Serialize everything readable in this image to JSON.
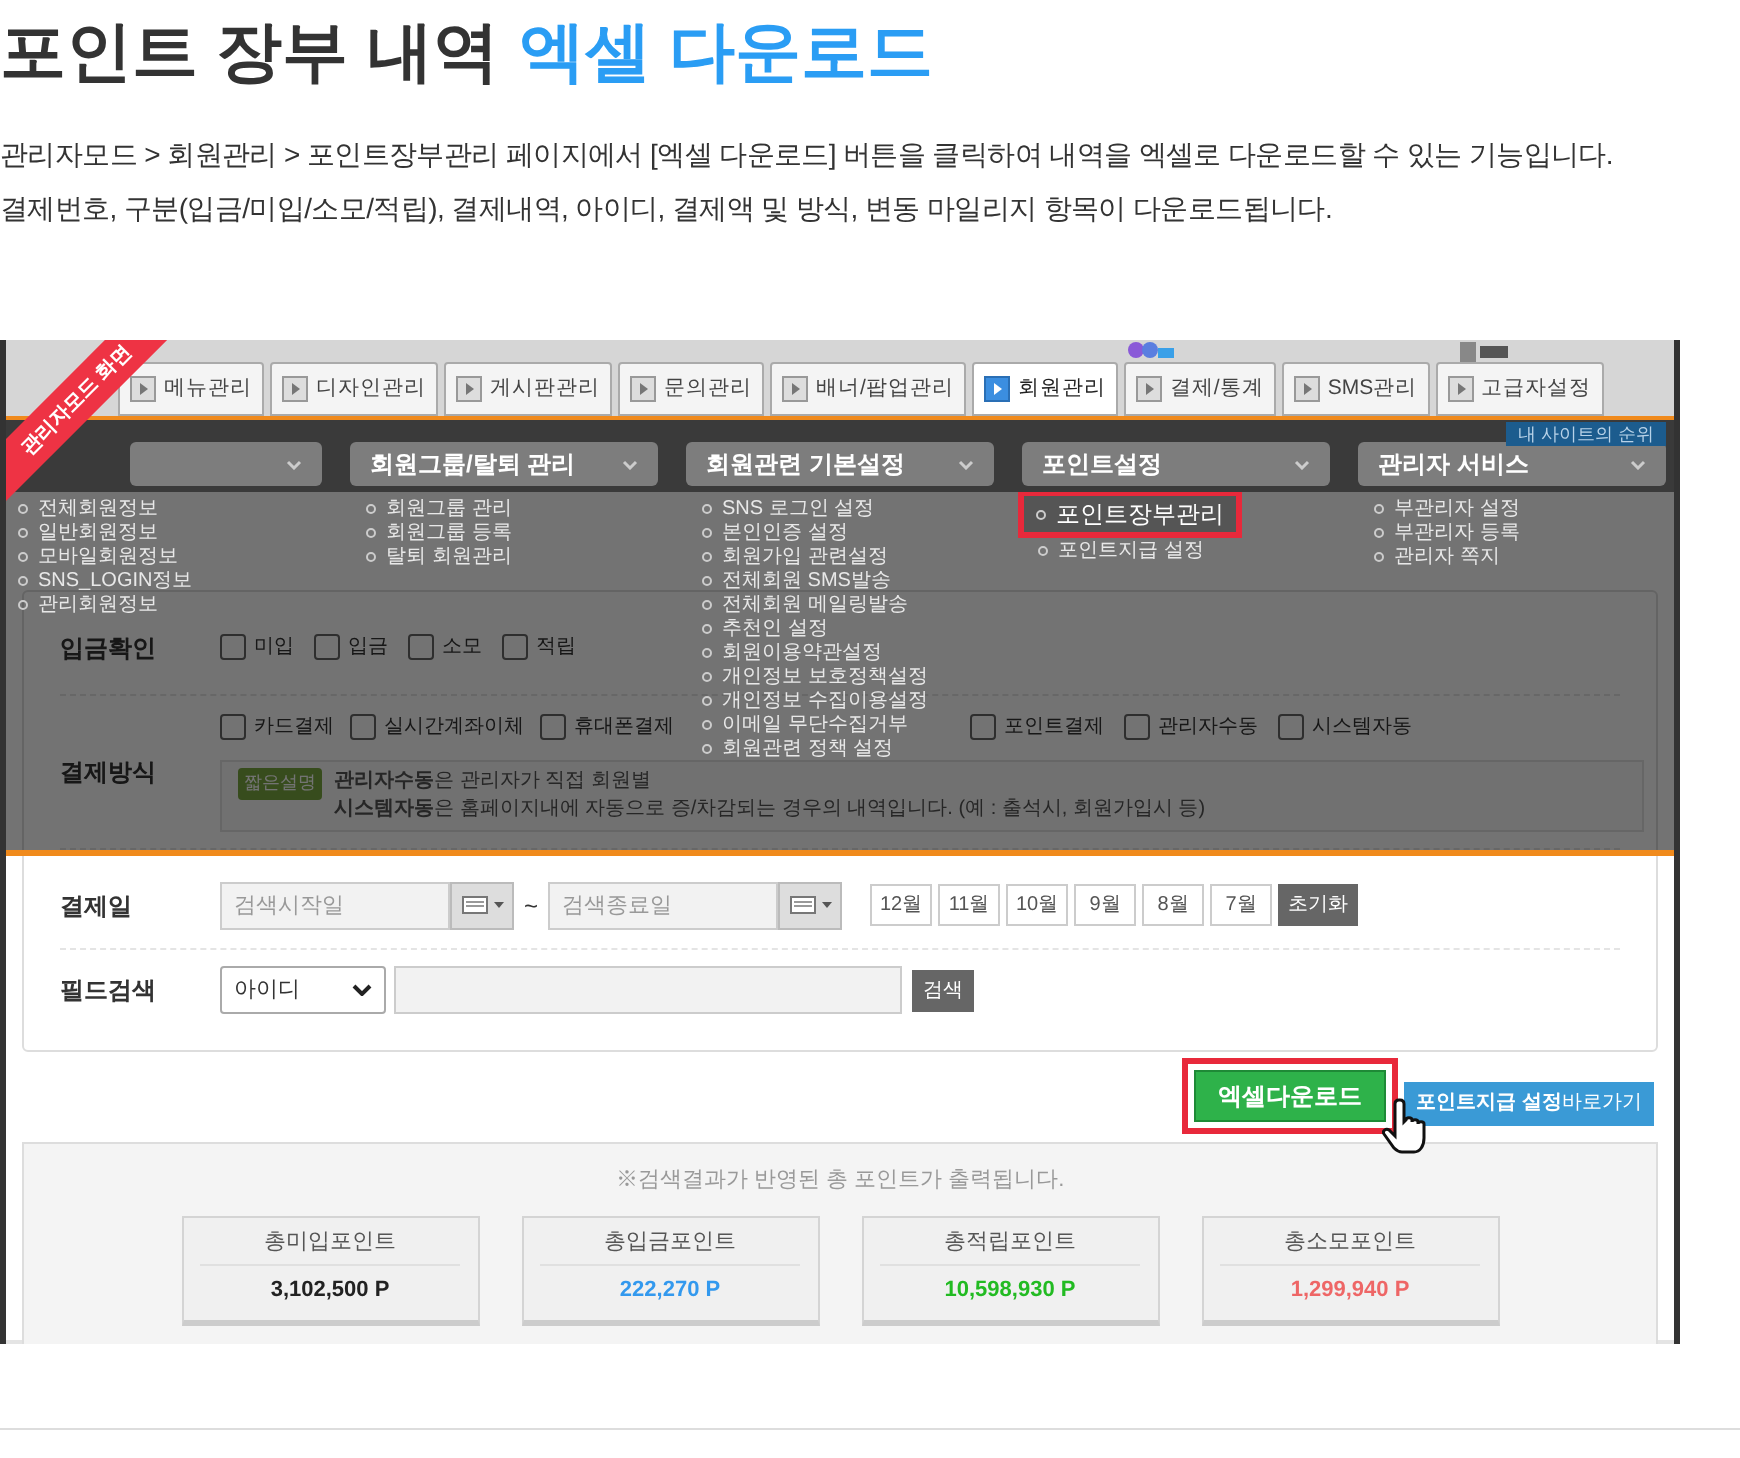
{
  "header": {
    "title": "포인트 장부 내역",
    "title_highlight": "엑셀 다운로드",
    "description": [
      "관리자모드 > 회원관리 > 포인트장부관리 페이지에서 [엑셀 다운로드] 버튼을 클릭하여 내역을 엑셀로 다운로드할 수 있는 기능입니다.",
      "결제번호, 구분(입금/미입/소모/적립), 결제내역, 아이디, 결제액 및 방식, 변동 마일리지 항목이 다운로드됩니다."
    ]
  },
  "ribbon": "관리자모드 화면",
  "tabs": [
    {
      "label": "메뉴관리",
      "selected": false
    },
    {
      "label": "디자인관리",
      "selected": false
    },
    {
      "label": "게시판관리",
      "selected": false
    },
    {
      "label": "문의관리",
      "selected": false
    },
    {
      "label": "배너/팝업관리",
      "selected": false
    },
    {
      "label": "회원관리",
      "selected": true
    },
    {
      "label": "결제/통계",
      "selected": false
    },
    {
      "label": "SMS관리",
      "selected": false
    },
    {
      "label": "고급자설정",
      "selected": false
    }
  ],
  "rank_button": "내 사이트의 순위",
  "menu": [
    {
      "items": [
        {
          "label": "전체회원정보",
          "selected": false
        },
        {
          "label": "일반회원정보",
          "selected": false
        },
        {
          "label": "모바일회원정보",
          "selected": false
        },
        {
          "label": "SNS_LOGIN정보",
          "selected": false
        },
        {
          "label": "관리회원정보",
          "selected": false
        }
      ]
    },
    {
      "label": "회원그룹/탈퇴 관리",
      "items": [
        {
          "label": "회원그룹 관리",
          "selected": false
        },
        {
          "label": "회원그룹 등록",
          "selected": false
        },
        {
          "label": "탈퇴 회원관리",
          "selected": false
        }
      ]
    },
    {
      "label": "회원관련 기본설정",
      "items": [
        {
          "label": "SNS 로그인 설정",
          "selected": false
        },
        {
          "label": "본인인증 설정",
          "selected": false
        },
        {
          "label": "회원가입 관련설정",
          "selected": false
        },
        {
          "label": "전체회원 SMS발송",
          "selected": false
        },
        {
          "label": "전체회원 메일링발송",
          "selected": false
        },
        {
          "label": "추천인 설정",
          "selected": false
        },
        {
          "label": "회원이용약관설정",
          "selected": false
        },
        {
          "label": "개인정보 보호정책설정",
          "selected": false
        },
        {
          "label": "개인정보 수집이용설정",
          "selected": false
        },
        {
          "label": "이메일 무단수집거부",
          "selected": false
        },
        {
          "label": "회원관련 정책 설정",
          "selected": false
        }
      ]
    },
    {
      "label": "포인트설정",
      "items": [
        {
          "label": "포인트장부관리",
          "selected": true
        },
        {
          "label": "포인트지급 설정",
          "selected": false
        }
      ]
    },
    {
      "label": "관리자 서비스",
      "items": [
        {
          "label": "부관리자 설정",
          "selected": false
        },
        {
          "label": "부관리자 등록",
          "selected": false
        },
        {
          "label": "관리자 쪽지",
          "selected": false
        }
      ]
    }
  ],
  "deposit": {
    "label": "입금확인",
    "options": [
      {
        "label": "미입",
        "checked": false
      },
      {
        "label": "입금",
        "checked": false
      },
      {
        "label": "소모",
        "checked": false
      },
      {
        "label": "적립",
        "checked": false
      }
    ]
  },
  "method": {
    "label": "결제방식",
    "options": [
      {
        "label": "카드결제",
        "checked": false
      },
      {
        "label": "실시간계좌이체",
        "checked": false
      },
      {
        "label": "휴대폰결제",
        "checked": false
      }
    ],
    "options_2": [
      {
        "label": "포인트결제",
        "checked": false
      },
      {
        "label": "관리자수동",
        "checked": false
      },
      {
        "label": "시스템자동",
        "checked": false
      }
    ],
    "note_tag": "짧은설명",
    "note": [
      "**관리자수동**은 관리자가 직접 회원별",
      "**시스템자동**은 홈페이지내에 자동으로 증/차감되는 경우의 내역입니다. (예 : 출석시, 회원가입시 등)"
    ]
  },
  "date": {
    "label": "결제일",
    "start_placeholder": "검색시작일",
    "separator": "~",
    "end_placeholder": "검색종료일",
    "months": [
      "12월",
      "11월",
      "10월",
      "9월",
      "8월",
      "7월"
    ],
    "reset": "초기화"
  },
  "field_search": {
    "label": "필드검색",
    "select": "아이디",
    "button": "검색"
  },
  "excel_button": {
    "label": "엑셀다운로드",
    "highlighted": true
  },
  "point_link": "**포인트지급 설정**바로가기",
  "summary": {
    "notice": "※검색결과가 반영된 총 포인트가 출력됩니다.",
    "cards": [
      {
        "label": "총미입포인트",
        "value": "3,102,500 P",
        "color": "#222222"
      },
      {
        "label": "총입금포인트",
        "value": "222,270 P",
        "color": "#3399ee"
      },
      {
        "label": "총적립포인트",
        "value": "10,598,930 P",
        "color": "#22bb22"
      },
      {
        "label": "총소모포인트",
        "value": "1,299,940 P",
        "color": "#ee6666"
      }
    ]
  }
}
